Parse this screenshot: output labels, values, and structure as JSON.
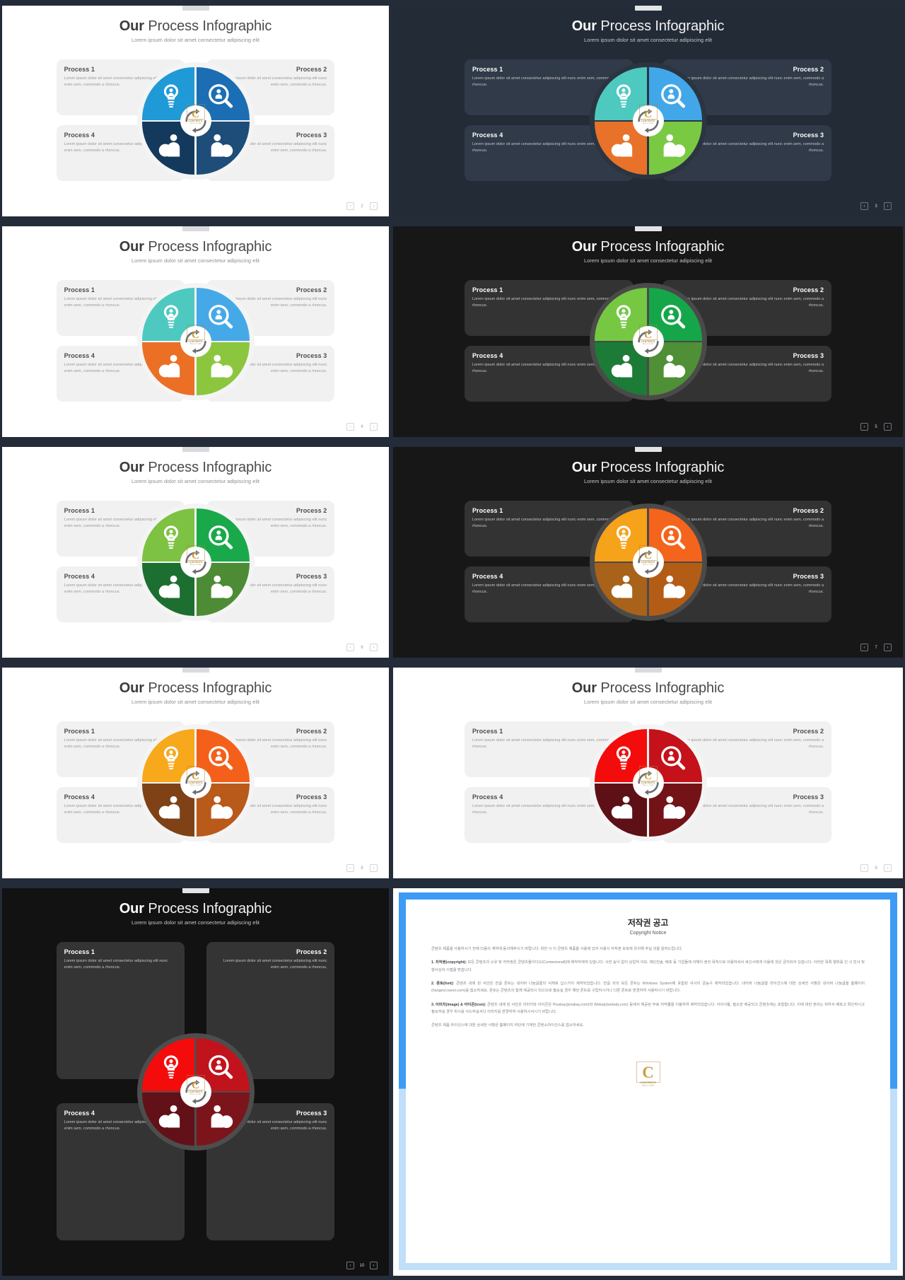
{
  "deck": {
    "title_bold": "Our",
    "title_rest": " Process Infographic",
    "subtitle": "Lorem ipsum dolor sit amet consectetur adipiscing elit",
    "process_labels": [
      "Process 1",
      "Process 2",
      "Process 3",
      "Process 4"
    ],
    "process_desc": "Lorem ipsum dolor sit amet consectetur adipiscing elit nunc enim sem, commodo a rhoncus.",
    "icon_names": [
      "idea-bulb-person-icon",
      "search-person-magnifier-icon",
      "person-pie-chart-icon",
      "person-dollar-coin-icon"
    ],
    "hub_icon": "circular-arrows-icon",
    "pager": {
      "prev": "‹",
      "next": "›"
    }
  },
  "watermark": {
    "letter": "C",
    "line1": "CONTENTS",
    "line2": "MALL.COM"
  },
  "slides": [
    {
      "page": "2",
      "theme": "light",
      "colors": {
        "q1": "#1f9ad6",
        "q2": "#1b6eb3",
        "q3": "#1d4d78",
        "q4": "#133a5c"
      }
    },
    {
      "page": "3",
      "theme": "dark-blue",
      "colors": {
        "q1": "#4ec9c0",
        "q2": "#42a7e8",
        "q3": "#7ac943",
        "q4": "#e8722a"
      }
    },
    {
      "page": "4",
      "theme": "light",
      "colors": {
        "q1": "#4ec9c0",
        "q2": "#45a9e8",
        "q3": "#8cc63f",
        "q4": "#ec6f26"
      }
    },
    {
      "page": "5",
      "theme": "dark-black",
      "colors": {
        "q1": "#76c843",
        "q2": "#16a64a",
        "q3": "#4f8f36",
        "q4": "#1c7b36"
      }
    },
    {
      "page": "6",
      "theme": "light",
      "colors": {
        "q1": "#7dc242",
        "q2": "#19a94b",
        "q3": "#4d8b34",
        "q4": "#1c6f31"
      }
    },
    {
      "page": "7",
      "theme": "dark-black",
      "colors": {
        "q1": "#f7a21b",
        "q2": "#f4641c",
        "q3": "#b35c16",
        "q4": "#a8621a"
      }
    },
    {
      "page": "8",
      "theme": "light",
      "colors": {
        "q1": "#f7a81b",
        "q2": "#f4601a",
        "q3": "#b9591a",
        "q4": "#7e4216"
      }
    },
    {
      "page": "9",
      "theme": "light",
      "colors": {
        "q1": "#f40c0c",
        "q2": "#c5111a",
        "q3": "#731318",
        "q4": "#5d1015"
      }
    },
    {
      "page": "10",
      "theme": "dark-charcoal",
      "colors": {
        "q1": "#f40c0c",
        "q2": "#c1131c",
        "q3": "#7b151b",
        "q4": "#611117"
      }
    }
  ],
  "copyright": {
    "heading": "저작권 공고",
    "subheading": "Copyright Notice",
    "intro": "콘텐츠 제품을 사용하시기 전에 다음의 계약에 동의해주시기 바랍니다. 위반 시 이 콘텐츠 제품을 사용에 있어 사용시 저작권 보호에 유의해 주실 것을 알려드립니다.",
    "clause1_label": "1. 저작권(copyright):",
    "clause1": "모든 콘텐츠의 소유 및 저작권은 콘텐츠몰이다오(Contentsmall)에 제작자에게 있습니다. 사전 승낙 없이 상업적 이보, 재단전송, 배포 등 기업들에 의해이 권리 목적으로 이용하셔서 세신사에게 이용에 것은 금지되어 있습니다. 이러한 목록 행위를 인 시 민사 및 형사상의 시벌을 받습니다.",
    "clause2_label": "2. 폰트(font):",
    "clause2": "콘텐츠 내에 된 서안은 한글 폰트는 네이버 나눔글꼴의 서체로 납스가이 제작되었습니다. 한글 외의 모든 폰트는 Windows System에 포함된 서사의 금능구 제작되었습니다. 네이버 나눔글꼴 라이선스에 대한 상세한 사항은 네이버 나눔글꼴 홈페이지(hangeul.naver.com)를 접소하세요. 폰트는 콘텐츠의 함께 제공되시 되으므로 필요실 경우 해당 폰트를 구립하시거나 다른 폰트로 변경하여 사용하시기 바랍니다.",
    "clause3_label": "3. 이미지(image) & 아이콘(icon):",
    "clause3": "콘텐츠 내에 된 서안은 이미지와 아이콘은 Pixabay(pixabay.com)와 Webaly(webaly.com) 등에서 제공된 무료 저작물을 이용하여 제작되었습니다. 아이사들, 필소만 제공되고 콘텐츠에는 포함합니다. 이에 대한 권리는 위하서 배포고 확인하시고 필요하실 경우 위시를 사드하실서다 이미지를 변경하여 사용하시서시기 바랍니다.",
    "footer": "콘텐츠 제품 라이선스에 대한 상세한 사항은 홈페이지 하단에 기재한 콘텐소라이선스를 접소하세요."
  }
}
